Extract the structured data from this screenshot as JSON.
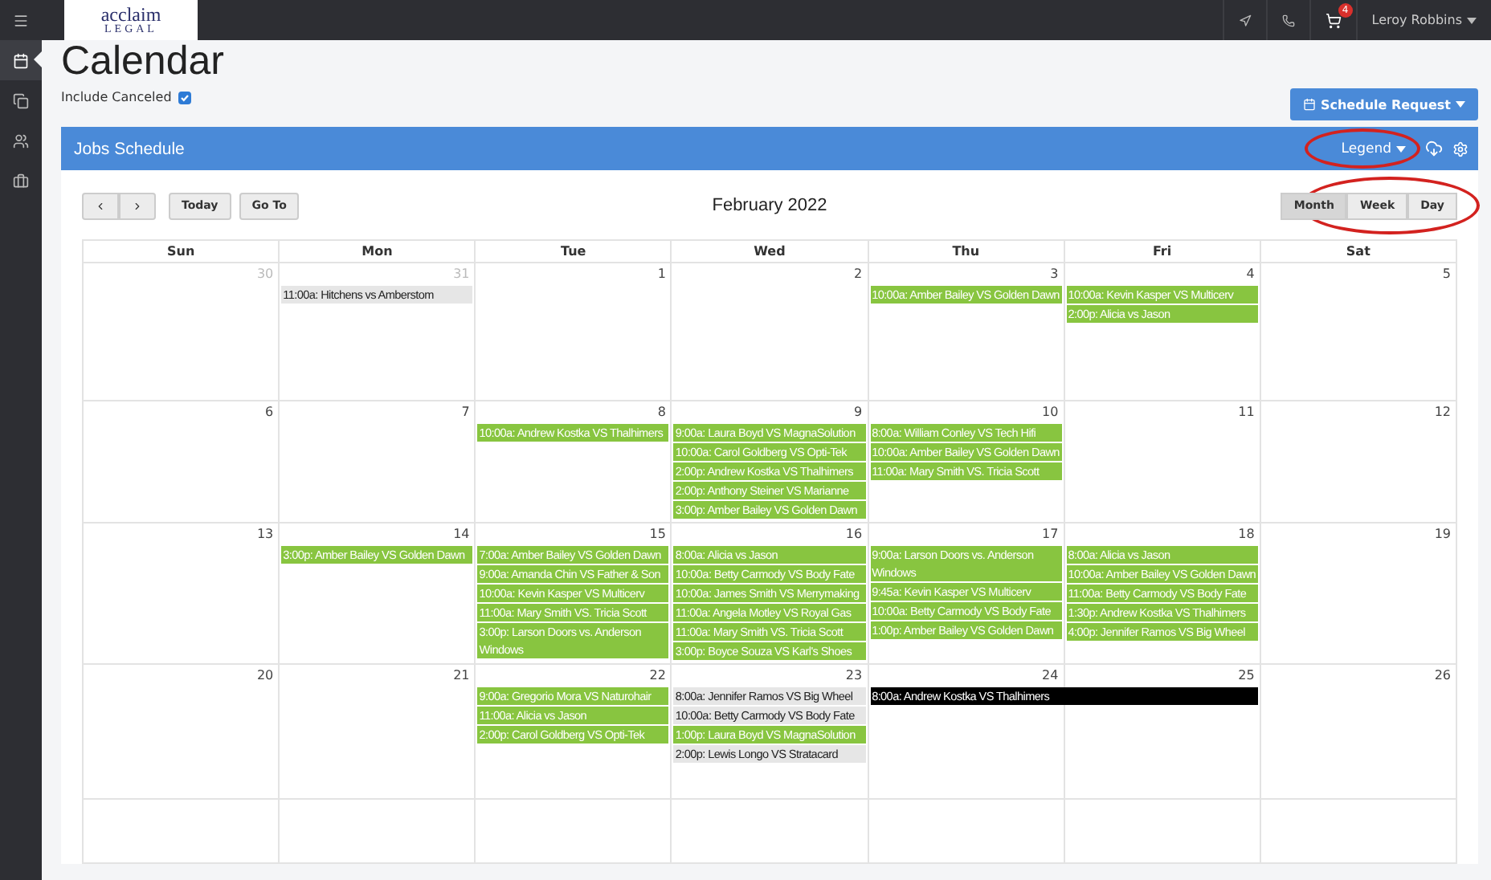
{
  "topbar": {
    "logo_text": "acclaim",
    "logo_subtext": "LEGAL",
    "cart_count": "4",
    "user": "Leroy Robbins"
  },
  "sidebar": {
    "items": [
      {
        "selected": false
      },
      {
        "selected": true
      },
      {
        "selected": false
      },
      {
        "selected": false
      },
      {
        "selected": false
      }
    ]
  },
  "page": {
    "title": "Calendar",
    "include_canceled": {
      "label": "Include Canceled",
      "checked": true
    },
    "schedule_button": "Schedule Request"
  },
  "panel": {
    "title": "Jobs Schedule",
    "legend": {
      "label": "Legend",
      "highlighted": true
    }
  },
  "toolbar": {
    "today": "Today",
    "goto": "Go To",
    "month_title": "February 2022",
    "views_highlighted": true,
    "views": [
      {
        "label": "Month",
        "selected": true
      },
      {
        "label": "Week",
        "selected": false
      },
      {
        "label": "Day",
        "selected": false
      }
    ]
  },
  "weekdays": [
    "Sun",
    "Mon",
    "Tue",
    "Wed",
    "Thu",
    "Fri",
    "Sat"
  ],
  "weeks": [
    {
      "days": [
        {
          "number": "30",
          "outside_month": true
        },
        {
          "number": "31",
          "outside_month": true,
          "events": [
            {
              "text": "11:00a: Hitchens vs Amberstom",
              "color": "#e6e6e6"
            }
          ]
        },
        {
          "number": "1",
          "outside_month": false
        },
        {
          "number": "2",
          "outside_month": false
        },
        {
          "number": "3",
          "outside_month": false,
          "events": [
            {
              "text": "10:00a: Amber Bailey VS Golden Dawn",
              "color": "#88c540"
            }
          ]
        },
        {
          "number": "4",
          "outside_month": false,
          "events": [
            {
              "text": "10:00a: Kevin Kasper VS Multicerv",
              "color": "#88c540"
            },
            {
              "text": "2:00p: Alicia vs Jason",
              "color": "#88c540"
            }
          ]
        },
        {
          "number": "5",
          "outside_month": false
        }
      ]
    },
    {
      "days": [
        {
          "number": "6",
          "outside_month": false
        },
        {
          "number": "7",
          "outside_month": false
        },
        {
          "number": "8",
          "outside_month": false,
          "events": [
            {
              "text": "10:00a: Andrew Kostka VS Thalhimers",
              "color": "#88c540"
            }
          ]
        },
        {
          "number": "9",
          "outside_month": false,
          "events": [
            {
              "text": "9:00a: Laura Boyd VS MagnaSolution",
              "color": "#88c540"
            },
            {
              "text": "10:00a: Carol Goldberg VS Opti-Tek",
              "color": "#88c540"
            },
            {
              "text": "2:00p: Andrew Kostka VS Thalhimers",
              "color": "#88c540"
            },
            {
              "text": "2:00p: Anthony Steiner VS Marianne",
              "color": "#88c540"
            },
            {
              "text": "3:00p: Amber Bailey VS Golden Dawn",
              "color": "#88c540"
            }
          ]
        },
        {
          "number": "10",
          "outside_month": false,
          "events": [
            {
              "text": "8:00a: William Conley VS Tech Hifi",
              "color": "#88c540"
            },
            {
              "text": "10:00a: Amber Bailey VS Golden Dawn",
              "color": "#88c540"
            },
            {
              "text": "11:00a: Mary Smith VS. Tricia Scott",
              "color": "#88c540"
            }
          ]
        },
        {
          "number": "11",
          "outside_month": false
        },
        {
          "number": "12",
          "outside_month": false
        }
      ]
    },
    {
      "days": [
        {
          "number": "13",
          "outside_month": false
        },
        {
          "number": "14",
          "outside_month": false,
          "events": [
            {
              "text": "3:00p: Amber Bailey VS Golden Dawn",
              "color": "#88c540"
            }
          ]
        },
        {
          "number": "15",
          "outside_month": false,
          "events": [
            {
              "text": "7:00a: Amber Bailey VS Golden Dawn",
              "color": "#88c540"
            },
            {
              "text": "9:00a: Amanda Chin VS Father & Son",
              "color": "#88c540"
            },
            {
              "text": "10:00a: Kevin Kasper VS Multicerv",
              "color": "#88c540"
            },
            {
              "text": "11:00a: Mary Smith VS. Tricia Scott",
              "color": "#88c540"
            },
            {
              "text": "3:00p: Larson Doors vs. Anderson Windows",
              "color": "#88c540"
            }
          ]
        },
        {
          "number": "16",
          "outside_month": false,
          "events": [
            {
              "text": "8:00a: Alicia vs Jason",
              "color": "#88c540"
            },
            {
              "text": "10:00a: Betty Carmody VS Body Fate",
              "color": "#88c540"
            },
            {
              "text": "10:00a: James Smith VS Merrymaking",
              "color": "#88c540"
            },
            {
              "text": "11:00a: Angela Motley VS Royal Gas",
              "color": "#88c540"
            },
            {
              "text": "11:00a: Mary Smith VS. Tricia Scott",
              "color": "#88c540"
            },
            {
              "text": "3:00p: Boyce Souza VS Karl's Shoes",
              "color": "#88c540"
            }
          ]
        },
        {
          "number": "17",
          "outside_month": false,
          "events": [
            {
              "text": "9:00a: Larson Doors vs. Anderson Windows",
              "color": "#88c540"
            },
            {
              "text": "9:45a: Kevin Kasper VS Multicerv",
              "color": "#88c540"
            },
            {
              "text": "10:00a: Betty Carmody VS Body Fate",
              "color": "#88c540"
            },
            {
              "text": "1:00p: Amber Bailey VS Golden Dawn",
              "color": "#88c540"
            }
          ]
        },
        {
          "number": "18",
          "outside_month": false,
          "events": [
            {
              "text": "8:00a: Alicia vs Jason",
              "color": "#88c540"
            },
            {
              "text": "10:00a: Amber Bailey VS Golden Dawn",
              "color": "#88c540"
            },
            {
              "text": "11:00a: Betty Carmody VS Body Fate",
              "color": "#88c540"
            },
            {
              "text": "1:30p: Andrew Kostka VS Thalhimers",
              "color": "#88c540"
            },
            {
              "text": "4:00p: Jennifer Ramos VS Big Wheel",
              "color": "#88c540"
            }
          ]
        },
        {
          "number": "19",
          "outside_month": false
        }
      ]
    },
    {
      "days": [
        {
          "number": "20",
          "outside_month": false
        },
        {
          "number": "21",
          "outside_month": false
        },
        {
          "number": "22",
          "outside_month": false,
          "events": [
            {
              "text": "9:00a: Gregorio Mora VS Naturohair",
              "color": "#88c540"
            },
            {
              "text": "11:00a: Alicia vs Jason",
              "color": "#88c540"
            },
            {
              "text": "2:00p: Carol Goldberg VS Opti-Tek",
              "color": "#88c540"
            }
          ]
        },
        {
          "number": "23",
          "outside_month": false,
          "events": [
            {
              "text": "8:00a: Jennifer Ramos VS Big Wheel",
              "color": "#e6e6e6"
            },
            {
              "text": "10:00a: Betty Carmody VS Body Fate",
              "color": "#e6e6e6"
            },
            {
              "text": "1:00p: Laura Boyd VS MagnaSolution",
              "color": "#88c540"
            },
            {
              "text": "2:00p: Lewis Longo VS Stratacard",
              "color": "#e6e6e6"
            }
          ]
        },
        {
          "number": "24",
          "outside_month": false,
          "events": [
            {
              "text": "8:00a: Andrew Kostka VS Thalhimers",
              "color": "#000000",
              "spans_next_day": true
            }
          ]
        },
        {
          "number": "25",
          "outside_month": false
        },
        {
          "number": "26",
          "outside_month": false
        }
      ]
    }
  ]
}
